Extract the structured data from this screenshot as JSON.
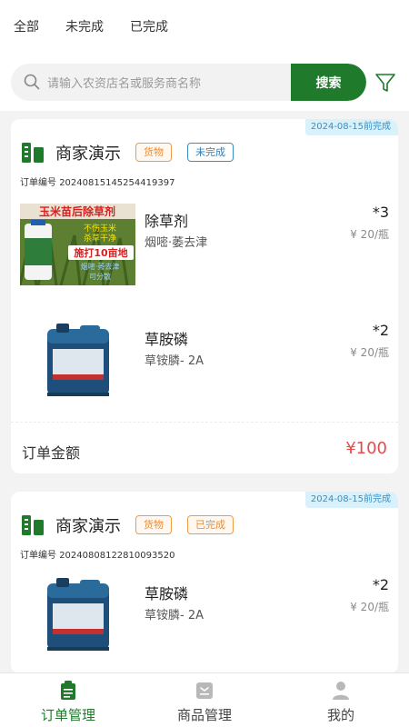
{
  "filter_tabs": [
    "全部",
    "未完成",
    "已完成"
  ],
  "search": {
    "placeholder": "请输入农资店名或服务商名称",
    "button_label": "搜索"
  },
  "orders": [
    {
      "due_label": "2024-08-15前完成",
      "shop_name": "商家演示",
      "type_tag": "货物",
      "status_tag": "未完成",
      "order_no_label": "订单编号",
      "order_no": "20240815145254419397",
      "items": [
        {
          "name": "除草剂",
          "spec": "烟嘧·萎去津",
          "qty": "*3",
          "price": "¥ 20/瓶",
          "image_text": {
            "title": "玉米苗后除草剂",
            "line1": "不伤玉米",
            "line2": "杀草干净",
            "line3": "施打10亩地",
            "line4": "烟嘧·莠去津",
            "line5": "可分散"
          }
        },
        {
          "name": "草胺磷",
          "spec": "草铵膦- 2A",
          "qty": "*2",
          "price": "¥ 20/瓶"
        }
      ],
      "total_label": "订单金额",
      "total_value": "¥100"
    },
    {
      "due_label": "2024-08-15前完成",
      "shop_name": "商家演示",
      "type_tag": "货物",
      "status_tag": "已完成",
      "order_no_label": "订单编号",
      "order_no": "20240808122810093520",
      "items": [
        {
          "name": "草胺磷",
          "spec": "草铵膦- 2A",
          "qty": "*2",
          "price": "¥ 20/瓶"
        }
      ]
    }
  ],
  "bottom_nav": [
    {
      "label": "订单管理",
      "icon": "clipboard-icon",
      "active": true
    },
    {
      "label": "商品管理",
      "icon": "box-icon",
      "active": false
    },
    {
      "label": "我的",
      "icon": "person-icon",
      "active": false
    }
  ],
  "colors": {
    "brand_green": "#1f7a2c",
    "price_red": "#e44b4b",
    "tag_orange": "#ef8a2c",
    "tag_blue": "#2f7fb2",
    "due_badge_bg": "#d9f1fb"
  }
}
